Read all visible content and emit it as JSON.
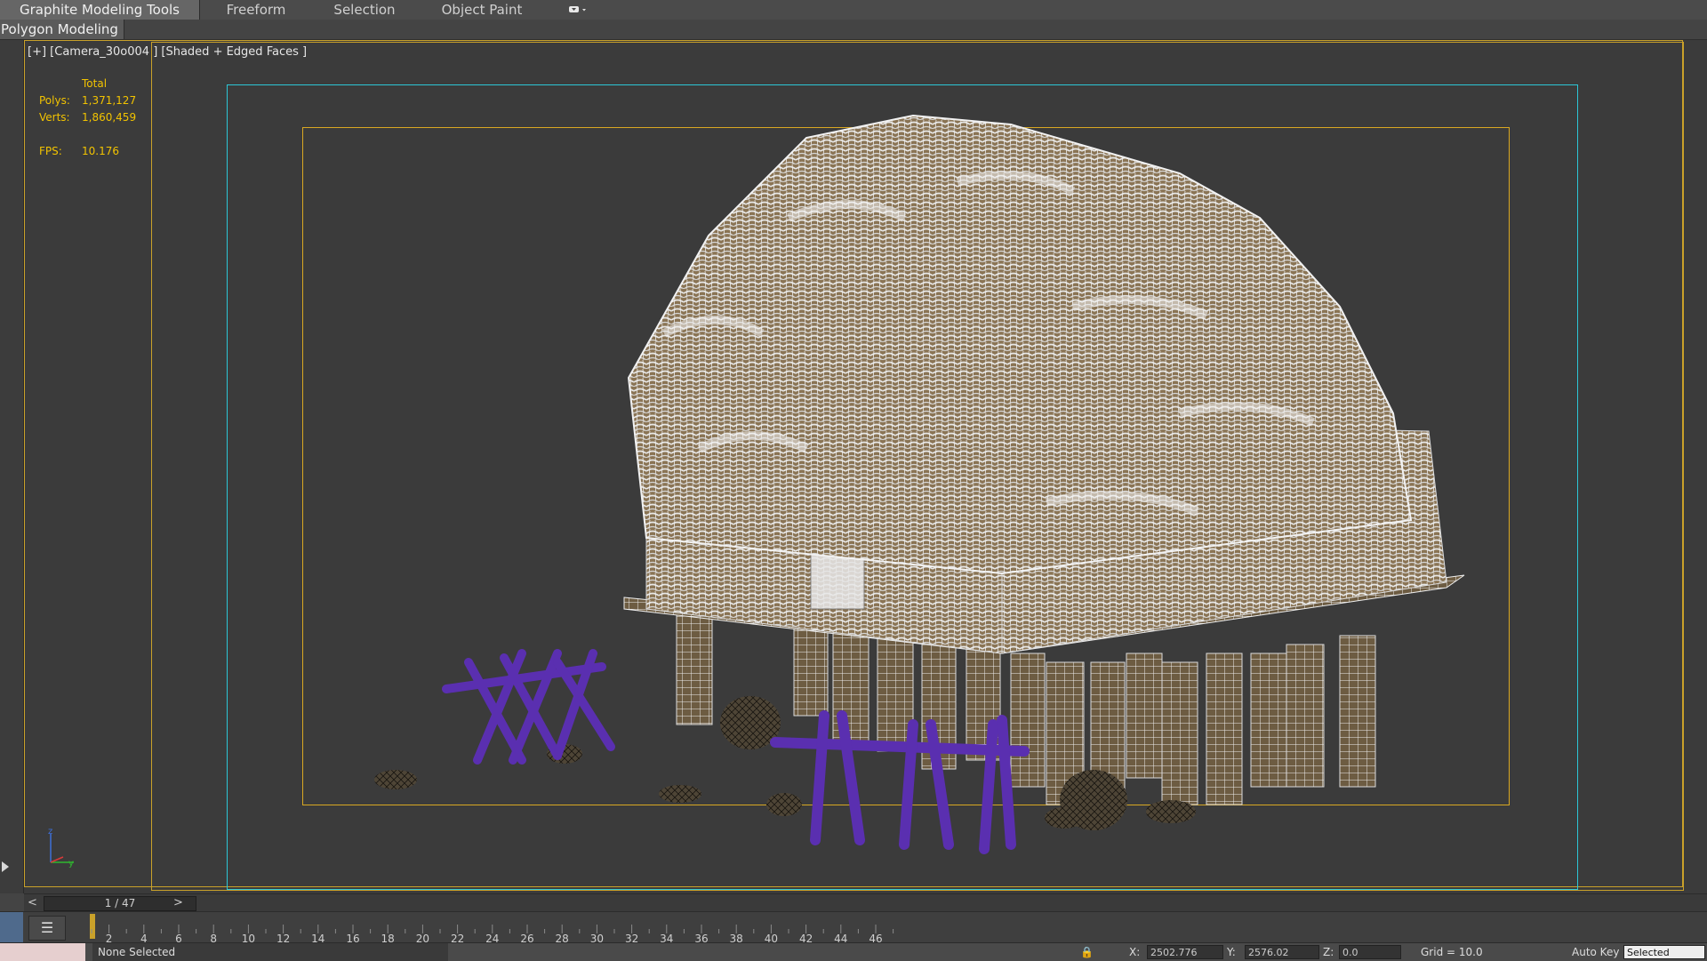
{
  "ribbon": {
    "tabs": [
      {
        "label": "Graphite Modeling Tools",
        "active": true
      },
      {
        "label": "Freeform",
        "active": false
      },
      {
        "label": "Selection",
        "active": false
      },
      {
        "label": "Object Paint",
        "active": false
      }
    ],
    "dropdown_icon": "toggle-dropdown-icon"
  },
  "subtab": {
    "label": "Polygon Modeling"
  },
  "viewport": {
    "label": "[+] [Camera_30o004 ] [Shaded + Edged Faces ]",
    "stats": {
      "header": "Total",
      "polys_label": "Polys:",
      "polys_value": "1,371,127",
      "verts_label": "Verts:",
      "verts_value": "1,860,459",
      "fps_label": "FPS:",
      "fps_value": "10.176"
    },
    "axis": {
      "z": "z",
      "y": "y"
    },
    "colors": {
      "safe_frame": "#c9a12a",
      "action_safe": "#2cc6d6",
      "selected_objects": "#5a2fb0"
    }
  },
  "time_slider": {
    "prev": "<",
    "value": "1 / 47",
    "next": ">"
  },
  "timeline": {
    "ticks": [
      "2",
      "4",
      "6",
      "8",
      "10",
      "12",
      "14",
      "16",
      "18",
      "20",
      "22",
      "24",
      "26",
      "28",
      "30",
      "32",
      "34",
      "36",
      "38",
      "40",
      "42",
      "44",
      "46"
    ]
  },
  "status": {
    "selection": "None Selected",
    "x_label": "X:",
    "x_value": "2502.776",
    "y_label": "Y:",
    "y_value": "2576.02",
    "z_label": "Z:",
    "z_value": "0.0",
    "grid": "Grid = 10.0",
    "autokey": "Auto Key",
    "selected": "Selected"
  }
}
